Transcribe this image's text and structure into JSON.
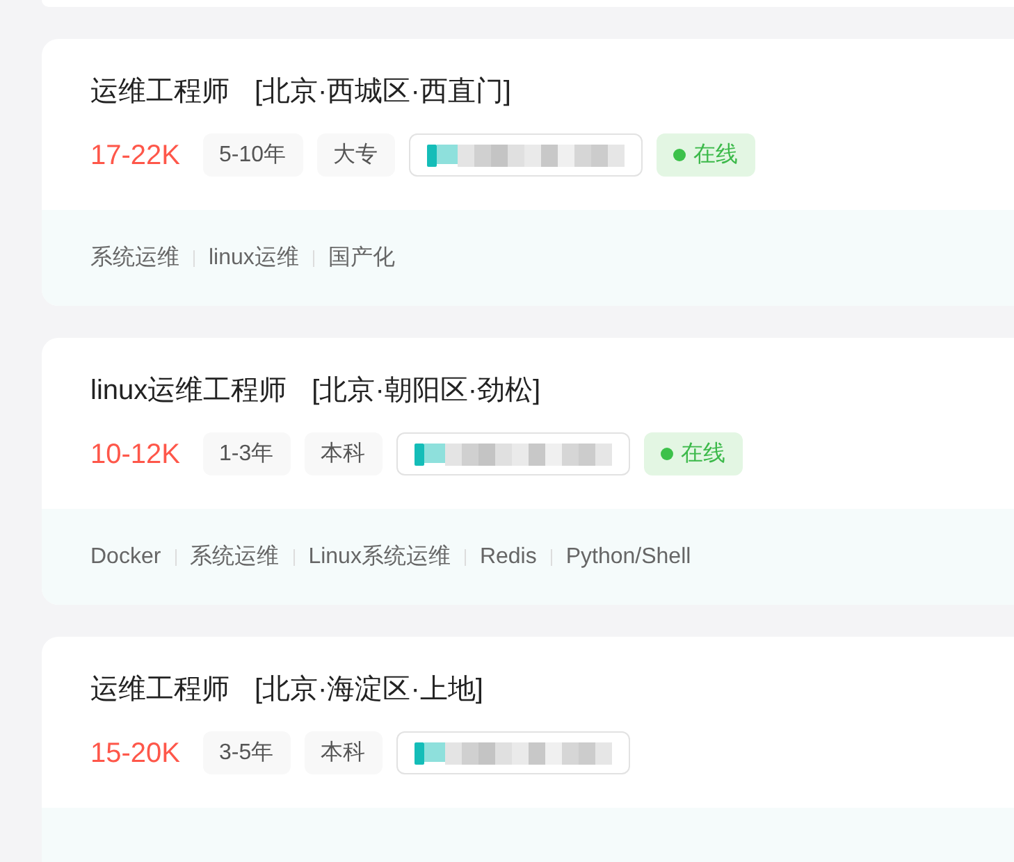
{
  "jobs": [
    {
      "title": "运维工程师",
      "location": "[北京·西城区·西直门]",
      "salary": "17-22K",
      "tags": [
        "5-10年",
        "大专"
      ],
      "status": {
        "label": "在线"
      },
      "skills": [
        "系统运维",
        "linux运维",
        "国产化"
      ]
    },
    {
      "title": "linux运维工程师",
      "location": "[北京·朝阳区·劲松]",
      "salary": "10-12K",
      "tags": [
        "1-3年",
        "本科"
      ],
      "status": {
        "label": "在线"
      },
      "skills": [
        "Docker",
        "系统运维",
        "Linux系统运维",
        "Redis",
        "Python/Shell"
      ]
    },
    {
      "title": "运维工程师",
      "location": "[北京·海淀区·上地]",
      "salary": "15-20K",
      "tags": [
        "3-5年",
        "本科"
      ]
    }
  ]
}
